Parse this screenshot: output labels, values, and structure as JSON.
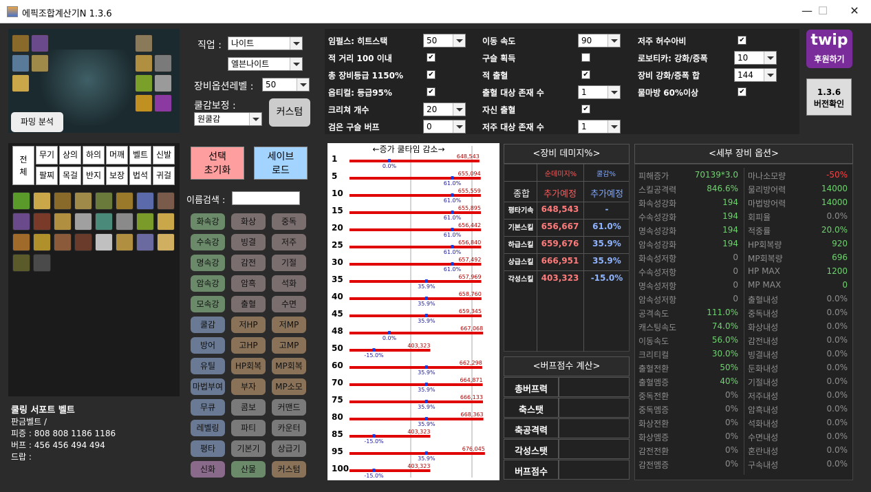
{
  "window": {
    "title": "에픽조합계산기N 1.3.6",
    "minimize": "—",
    "maximize": "☐",
    "close": "✕"
  },
  "left": {
    "parsing_button": "파밍 분석",
    "job_label": "직업 :",
    "job_value": "나이트",
    "subjob_value": "엘븐나이트",
    "equip_level_label": "장비옵션레벨 :",
    "equip_level_value": "50",
    "cooldown_label": "쿨감보정 :",
    "cooldown_value": "원쿨감",
    "custom_button": "커스텀",
    "reset_button": "선택\n초기화",
    "save_button": "세이브\n로드",
    "search_label": "이름검색 :",
    "search_value": "",
    "categories": [
      "무기",
      "상의",
      "하의",
      "머깨",
      "벨트",
      "신발",
      "팔찌",
      "목걸",
      "반지",
      "보장",
      "법석",
      "귀걸"
    ],
    "all_label": "전\n체",
    "stat_buttons": [
      "화속강",
      "화상",
      "중독",
      "수속강",
      "빙결",
      "저주",
      "명속강",
      "감전",
      "기절",
      "암속강",
      "암흑",
      "석화",
      "모속강",
      "출혈",
      "수면",
      "쿨감",
      "저HP",
      "저MP",
      "방어",
      "고HP",
      "고MP",
      "유틸",
      "HP회복",
      "MP회복",
      "마법부여",
      "부자",
      "MP소모",
      "무큐",
      "콤보",
      "커맨드",
      "레벨링",
      "파티",
      "카운터",
      "평타",
      "기본기",
      "상급기",
      "신화",
      "산물",
      "커스텀"
    ],
    "belt_title": "쿨링 서포트 벨트",
    "belt_lines": [
      "판금벨트 /",
      "피증 : 808 808 1186 1186",
      "버프 : 456 456 494 494",
      "드랍 :"
    ]
  },
  "options": {
    "col1": [
      {
        "label": "임펄스: 히트스택",
        "type": "combo",
        "value": "50"
      },
      {
        "label": "적 거리 100 이내",
        "type": "check",
        "checked": true
      },
      {
        "label": "총 장비등급 1150%",
        "type": "check",
        "checked": true
      },
      {
        "label": "옵티컬: 등급95%",
        "type": "check",
        "checked": true
      },
      {
        "label": "크리쳐 개수",
        "type": "combo",
        "value": "20"
      },
      {
        "label": "검은 구슬 버프",
        "type": "combo",
        "value": "0"
      }
    ],
    "col2": [
      {
        "label": "이동 속도",
        "type": "combo",
        "value": "90"
      },
      {
        "label": "구슬 획득",
        "type": "check",
        "checked": false
      },
      {
        "label": "적 출혈",
        "type": "check",
        "checked": true
      },
      {
        "label": "출혈 대상 존재 수",
        "type": "combo",
        "value": "1"
      },
      {
        "label": "자신 출혈",
        "type": "check",
        "checked": true
      },
      {
        "label": "저주 대상 존재 수",
        "type": "combo",
        "value": "1"
      }
    ],
    "col3": [
      {
        "label": "저주 허수아비",
        "type": "check",
        "checked": true
      },
      {
        "label": "로보티카: 강화/증폭",
        "type": "combo",
        "value": "10"
      },
      {
        "label": "장비 강화/증폭 합",
        "type": "combo",
        "value": "144"
      },
      {
        "label": "물마방 60%이상",
        "type": "check",
        "checked": true
      }
    ]
  },
  "twip": {
    "logo": "twip",
    "label": "후원하기"
  },
  "version_button": "1.3.6\n버전확인",
  "chart": {
    "header": "←증가  쿨타임  감소→",
    "rows": [
      {
        "level": "1",
        "dmg": "648,543",
        "cd": "0.0%",
        "dmgv": 648543,
        "cdv": 0.0
      },
      {
        "level": "5",
        "dmg": "655,094",
        "cd": "61.0%",
        "dmgv": 655094,
        "cdv": 61.0
      },
      {
        "level": "10",
        "dmg": "655,559",
        "cd": "61.0%",
        "dmgv": 655559,
        "cdv": 61.0
      },
      {
        "level": "15",
        "dmg": "655,895",
        "cd": "61.0%",
        "dmgv": 655895,
        "cdv": 61.0
      },
      {
        "level": "20",
        "dmg": "656,442",
        "cd": "61.0%",
        "dmgv": 656442,
        "cdv": 61.0
      },
      {
        "level": "25",
        "dmg": "656,840",
        "cd": "61.0%",
        "dmgv": 656840,
        "cdv": 61.0
      },
      {
        "level": "30",
        "dmg": "657,492",
        "cd": "61.0%",
        "dmgv": 657492,
        "cdv": 61.0
      },
      {
        "level": "35",
        "dmg": "657,969",
        "cd": "35.9%",
        "dmgv": 657969,
        "cdv": 35.9
      },
      {
        "level": "40",
        "dmg": "658,760",
        "cd": "35.9%",
        "dmgv": 658760,
        "cdv": 35.9
      },
      {
        "level": "45",
        "dmg": "659,345",
        "cd": "35.9%",
        "dmgv": 659345,
        "cdv": 35.9
      },
      {
        "level": "48",
        "dmg": "667,068",
        "cd": "0.0%",
        "dmgv": 667068,
        "cdv": 0.0
      },
      {
        "level": "50",
        "dmg": "403,323",
        "cd": "-15.0%",
        "dmgv": 403323,
        "cdv": -15.0
      },
      {
        "level": "60",
        "dmg": "662,298",
        "cd": "35.9%",
        "dmgv": 662298,
        "cdv": 35.9
      },
      {
        "level": "70",
        "dmg": "664,871",
        "cd": "35.9%",
        "dmgv": 664871,
        "cdv": 35.9
      },
      {
        "level": "75",
        "dmg": "666,133",
        "cd": "35.9%",
        "dmgv": 666133,
        "cdv": 35.9
      },
      {
        "level": "80",
        "dmg": "668,363",
        "cd": "35.9%",
        "dmgv": 668363,
        "cdv": 35.9
      },
      {
        "level": "85",
        "dmg": "403,323",
        "cd": "-15.0%",
        "dmgv": 403323,
        "cdv": -15.0
      },
      {
        "level": "95",
        "dmg": "676,045",
        "cd": "35.9%",
        "dmgv": 676045,
        "cdv": 35.9
      },
      {
        "level": "100",
        "dmg": "403,323",
        "cd": "-15.0%",
        "dmgv": 403323,
        "cdv": -15.0
      }
    ]
  },
  "damage": {
    "header": "<장비 데미지%>",
    "col_dmg": "순데미지%",
    "col_cd": "쿨감%",
    "total_label": "종합",
    "total_dmg": "추가예정",
    "total_cd": "추가예정",
    "rows": [
      {
        "name": "평타기속",
        "dmg": "648,543",
        "cd": "-"
      },
      {
        "name": "기본스킬",
        "dmg": "656,667",
        "cd": "61.0%"
      },
      {
        "name": "하급스킬",
        "dmg": "659,676",
        "cd": "35.9%"
      },
      {
        "name": "상급스킬",
        "dmg": "666,951",
        "cd": "35.9%"
      },
      {
        "name": "각성스킬",
        "dmg": "403,323",
        "cd": "-15.0%"
      }
    ]
  },
  "buff": {
    "header": "<버프점수 계산>",
    "rows": [
      "총버프력",
      "축스탯",
      "축공격력",
      "각성스탯",
      "버프점수"
    ]
  },
  "detail": {
    "header": "<세부 장비 옵션>",
    "left": [
      [
        "피해증가",
        "70139*3.0"
      ],
      [
        "스킬공격력",
        "846.6%"
      ],
      [
        "화속성강화",
        "194"
      ],
      [
        "수속성강화",
        "194"
      ],
      [
        "명속성강화",
        "194"
      ],
      [
        "암속성강화",
        "194"
      ],
      [
        "화속성저항",
        "0"
      ],
      [
        "수속성저항",
        "0"
      ],
      [
        "명속성저항",
        "0"
      ],
      [
        "암속성저항",
        "0"
      ],
      [
        "공격속도",
        "111.0%"
      ],
      [
        "캐스팅속도",
        "74.0%"
      ],
      [
        "이동속도",
        "56.0%"
      ],
      [
        "크리티컬",
        "30.0%"
      ],
      [
        "출혈전환",
        "50%"
      ],
      [
        "출혈멤증",
        "40%"
      ],
      [
        "중독전환",
        "0%"
      ],
      [
        "중독멤증",
        "0%"
      ],
      [
        "화상전환",
        "0%"
      ],
      [
        "화상멤증",
        "0%"
      ],
      [
        "감전전환",
        "0%"
      ],
      [
        "감전멤증",
        "0%"
      ]
    ],
    "right": [
      [
        "마나소모량",
        "-50%"
      ],
      [
        "물리방어력",
        "14000"
      ],
      [
        "마법방어력",
        "14000"
      ],
      [
        "회피율",
        "0.0%"
      ],
      [
        "적중률",
        "20.0%"
      ],
      [
        "HP회복량",
        "920"
      ],
      [
        "MP회복량",
        "696"
      ],
      [
        "HP MAX",
        "1200"
      ],
      [
        "MP MAX",
        "0"
      ],
      [
        "출혈내성",
        "0.0%"
      ],
      [
        "중독내성",
        "0.0%"
      ],
      [
        "화상내성",
        "0.0%"
      ],
      [
        "감전내성",
        "0.0%"
      ],
      [
        "빙결내성",
        "0.0%"
      ],
      [
        "둔화내성",
        "0.0%"
      ],
      [
        "기절내성",
        "0.0%"
      ],
      [
        "저주내성",
        "0.0%"
      ],
      [
        "암흑내성",
        "0.0%"
      ],
      [
        "석화내성",
        "0.0%"
      ],
      [
        "수면내성",
        "0.0%"
      ],
      [
        "혼란내성",
        "0.0%"
      ],
      [
        "구속내성",
        "0.0%"
      ]
    ]
  },
  "colors": {
    "accent_red": "#ff4040",
    "accent_blue": "#7fa7ff",
    "bar_red": "#e00000",
    "bar_blue": "#1a3cd8"
  }
}
